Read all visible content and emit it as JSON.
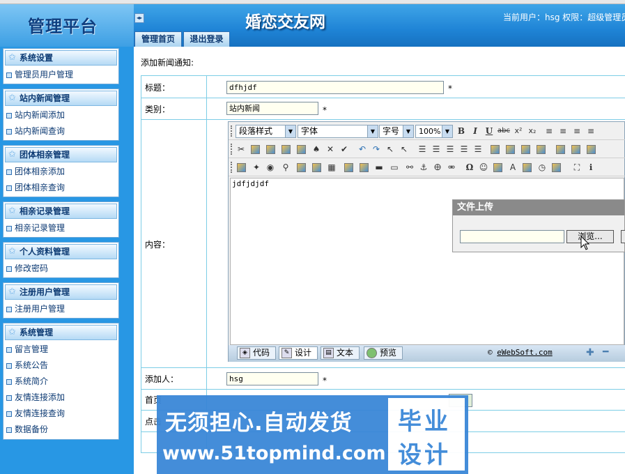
{
  "header": {
    "logo": "管理平台",
    "site_title": "婚恋交友网",
    "user_info": "当前用户：hsg 权限：超级管理员",
    "collapse_glyph": "◂▸",
    "tabs": [
      "管理首页",
      "退出登录"
    ]
  },
  "sidebar": {
    "groups": [
      {
        "title": "系统设置",
        "items": [
          "管理员用户管理"
        ]
      },
      {
        "title": "站内新闻管理",
        "items": [
          "站内新闻添加",
          "站内新闻查询"
        ]
      },
      {
        "title": "团体相亲管理",
        "items": [
          "团体相亲添加",
          "团体相亲查询"
        ]
      },
      {
        "title": "相亲记录管理",
        "items": [
          "相亲记录管理"
        ]
      },
      {
        "title": "个人资料管理",
        "items": [
          "修改密码"
        ]
      },
      {
        "title": "注册用户管理",
        "items": [
          "注册用户管理"
        ]
      },
      {
        "title": "系统管理",
        "items": [
          "留言管理",
          "系统公告",
          "系统简介",
          "友情连接添加",
          "友情连接查询",
          "数据备份"
        ]
      }
    ]
  },
  "form": {
    "title": "添加新闻通知:",
    "labels": {
      "title": "标题：",
      "category": "类别：",
      "content": "内容：",
      "author": "添加人：",
      "home": "首页",
      "clicks": "点击"
    },
    "values": {
      "title": "dfhjdf",
      "category": "站内新闻",
      "author": "hsg"
    },
    "required_mark": "*"
  },
  "editor": {
    "selects": [
      "段落样式",
      "字体",
      "字号",
      "100%"
    ],
    "content_text": "jdfjdjdf",
    "modes": [
      "代码",
      "设计",
      "文本",
      "预览"
    ],
    "copyright_prefix": "©",
    "copyright_link": "eWebSoft.com",
    "zoom_in": "✚",
    "zoom_out": "━"
  },
  "upload_dialog": {
    "title": "文件上传",
    "browse_label": "浏览..."
  },
  "watermark": {
    "line1": "无须担心.自动发货",
    "line2": "www.51topmind.com",
    "box_line1": "毕业",
    "box_line2": "设计"
  }
}
